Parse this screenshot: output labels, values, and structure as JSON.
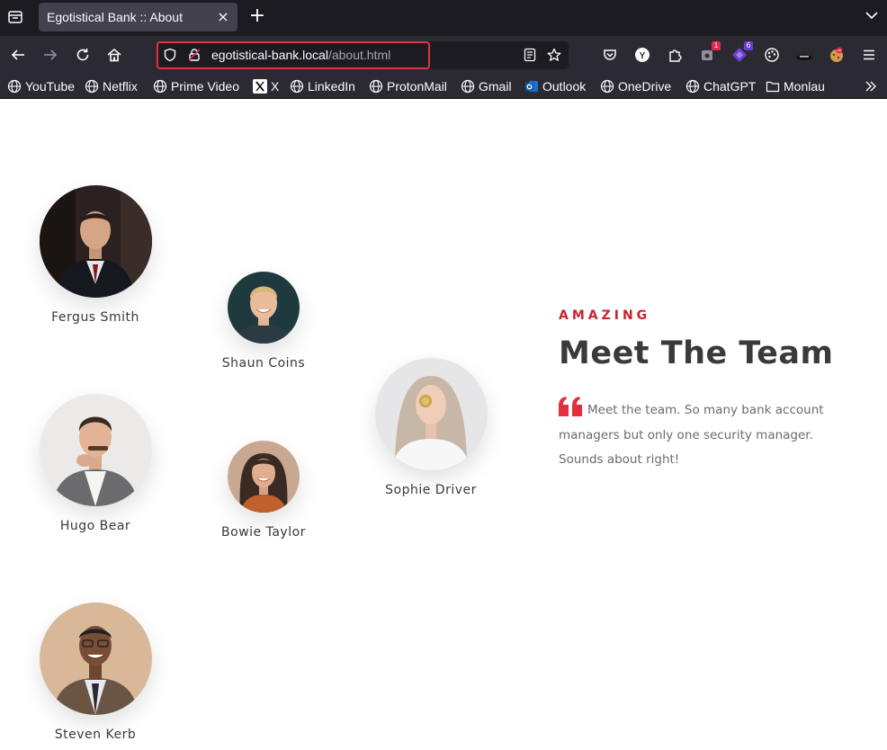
{
  "browser": {
    "tab_title": "Egotistical Bank :: About",
    "url_host": "egotistical-bank.local",
    "url_path": "/about.html",
    "extension_badges": {
      "notifications": "1",
      "purple": "6"
    },
    "bookmarks": [
      {
        "label": "YouTube",
        "icon": "globe-icon"
      },
      {
        "label": "Netflix",
        "icon": "globe-icon"
      },
      {
        "label": "Prime Video",
        "icon": "globe-icon"
      },
      {
        "label": "X",
        "icon": "x-logo-icon"
      },
      {
        "label": "LinkedIn",
        "icon": "globe-icon"
      },
      {
        "label": "ProtonMail",
        "icon": "globe-icon"
      },
      {
        "label": "Gmail",
        "icon": "globe-icon"
      },
      {
        "label": "Outlook",
        "icon": "outlook-icon"
      },
      {
        "label": "OneDrive",
        "icon": "globe-icon"
      },
      {
        "label": "ChatGPT",
        "icon": "globe-icon"
      },
      {
        "label": "Monlau",
        "icon": "folder-icon"
      }
    ]
  },
  "team": {
    "members": [
      {
        "name": "Fergus Smith"
      },
      {
        "name": "Shaun Coins"
      },
      {
        "name": "Hugo Bear"
      },
      {
        "name": "Bowie Taylor"
      },
      {
        "name": "Sophie Driver"
      },
      {
        "name": "Steven Kerb"
      }
    ],
    "eyebrow": "AMAZING",
    "heading": "Meet The Team",
    "quote": "Meet the team. So many bank account managers but only one security manager. Sounds about right!"
  },
  "colors": {
    "accent": "#d0202f",
    "chrome_dark": "#1c1b22",
    "chrome": "#2b2a33",
    "heading": "#3a3a3a"
  }
}
